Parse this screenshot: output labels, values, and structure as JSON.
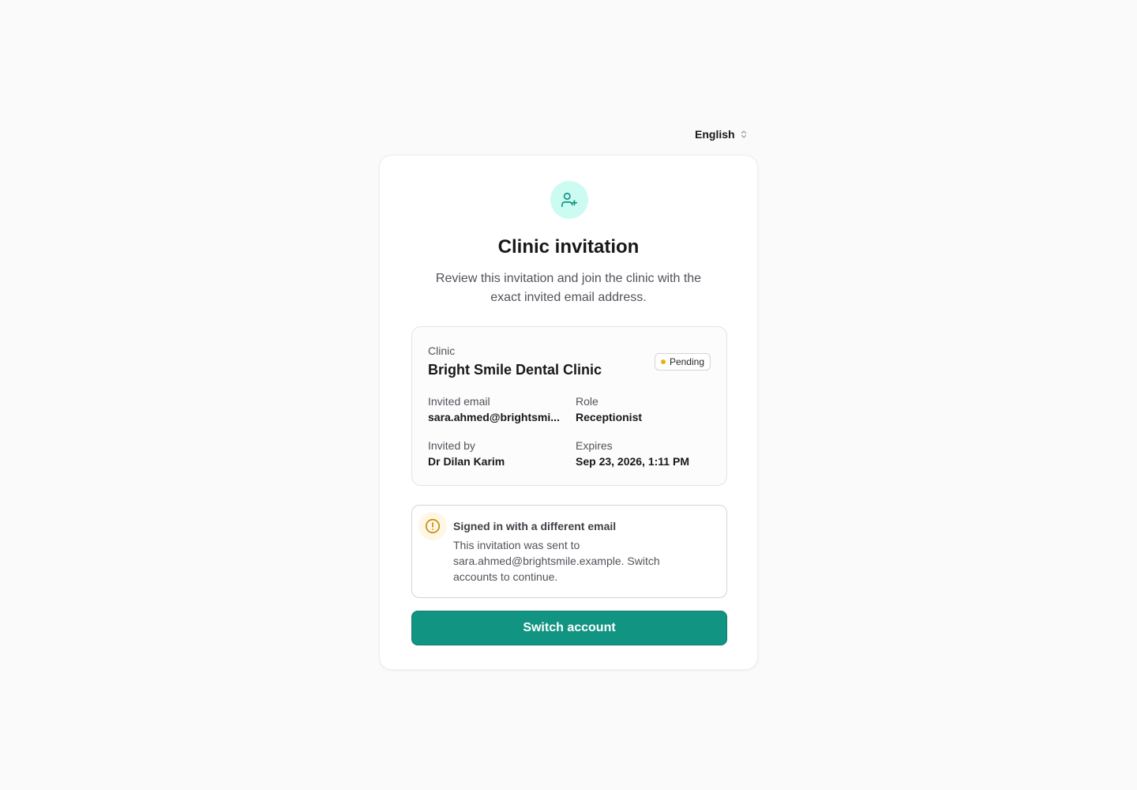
{
  "language": {
    "selected": "English",
    "icon": "chevron-up-down-icon"
  },
  "card": {
    "icon": "user-plus-icon",
    "title": "Clinic invitation",
    "subtitle": "Review this invitation and join the clinic with the exact invited email address."
  },
  "details": {
    "clinic_label": "Clinic",
    "clinic_name": "Bright Smile Dental Clinic",
    "status": {
      "label": "Pending",
      "color": "#eab308"
    },
    "invited_email_label": "Invited email",
    "invited_email_value": "sara.ahmed@brightsmi...",
    "role_label": "Role",
    "role_value": "Receptionist",
    "invited_by_label": "Invited by",
    "invited_by_value": "Dr Dilan Karim",
    "expires_label": "Expires",
    "expires_value": "Sep 23, 2026, 1:11 PM"
  },
  "alert": {
    "icon": "alert-circle-icon",
    "title": "Signed in with a different email",
    "body": "This invitation was sent to sara.ahmed@brightsmile.example. Switch accounts to continue."
  },
  "actions": {
    "switch_label": "Switch account"
  },
  "colors": {
    "accent": "#129482",
    "icon_bg": "#ccfbf1",
    "warning": "#ca8a04"
  }
}
